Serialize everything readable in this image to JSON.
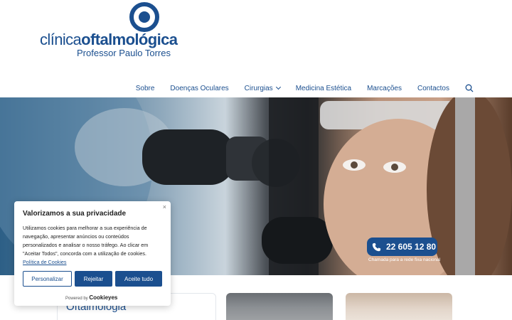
{
  "header": {
    "logo_brand_light": "clínica",
    "logo_brand_bold": "oftalmológica",
    "logo_subtitle": "Professor Paulo Torres"
  },
  "nav": {
    "items": [
      "Sobre",
      "Doenças Oculares",
      "Cirurgias",
      "Medicina Estética",
      "Marcações",
      "Contactos"
    ],
    "search_icon": "search-icon"
  },
  "hero": {
    "phone_number": "22 605 12 80",
    "phone_note": "Chamada para a rede fixa nacional"
  },
  "cards": {
    "first_title": "Oftalmologia"
  },
  "cookie": {
    "close": "×",
    "title": "Valorizamos a sua privacidade",
    "body": "Utilizamos cookies para melhorar a sua experiência de navegação, apresentar anúncios ou conteúdos personalizados e analisar o nosso tráfego. Ao clicar em \"Aceitar Todos\", concorda com a utilização de cookies.",
    "link": "Política de Cookies",
    "buttons": {
      "customize": "Personalizar",
      "reject": "Rejeitar",
      "accept": "Aceite tudo"
    },
    "powered_prefix": "Powered by",
    "powered_brand": "Cookieyes"
  },
  "colors": {
    "brand": "#1b4f8f"
  }
}
